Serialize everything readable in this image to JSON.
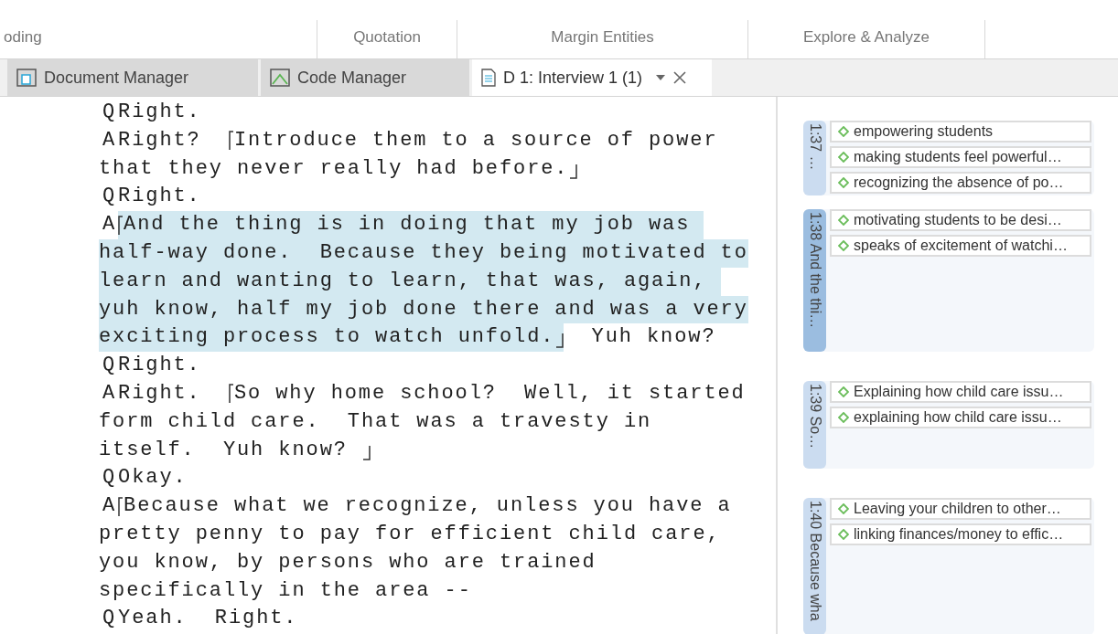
{
  "ribbon": {
    "groups": [
      "oding",
      "Quotation",
      "Margin Entities",
      "Explore & Analyze"
    ]
  },
  "tabs": [
    {
      "label": "Document Manager",
      "kind": "documents",
      "selected": false
    },
    {
      "label": "Code Manager",
      "kind": "codes",
      "selected": false
    },
    {
      "label": "D 1: Interview 1 (1)",
      "kind": "document",
      "selected": true
    }
  ],
  "transcript": [
    {
      "speaker": "Q",
      "segments": [
        {
          "text": "Right.",
          "highlighted": false,
          "quote_start": false,
          "quote_end": false
        }
      ]
    },
    {
      "speaker": "A",
      "segments": [
        {
          "text": "Right?  ",
          "highlighted": false,
          "quote_start": false,
          "quote_end": false
        },
        {
          "text": "Introduce them to a source of power",
          "highlighted": false,
          "quote_start": true,
          "quote_end": false
        }
      ]
    },
    {
      "segments": [
        {
          "text": "that they never really had before.",
          "highlighted": false,
          "quote_start": false,
          "quote_end": true
        }
      ]
    },
    {
      "speaker": "Q",
      "segments": [
        {
          "text": "Right.",
          "highlighted": false,
          "quote_start": false,
          "quote_end": false
        }
      ]
    },
    {
      "speaker": "A",
      "segments": [
        {
          "text": "And the thing is in doing that my job was ",
          "highlighted": true,
          "quote_start": true,
          "quote_end": false
        }
      ]
    },
    {
      "segments": [
        {
          "text": "half-way done.  Because they being motivated to",
          "highlighted": true,
          "quote_start": false,
          "quote_end": false
        }
      ]
    },
    {
      "segments": [
        {
          "text": "learn and wanting to learn, that was, again, ",
          "highlighted": true,
          "quote_start": false,
          "quote_end": false
        }
      ]
    },
    {
      "segments": [
        {
          "text": "yuh know, half my job done there and was a very",
          "highlighted": true,
          "quote_start": false,
          "quote_end": false
        }
      ]
    },
    {
      "segments": [
        {
          "text": "exciting process to watch unfold.",
          "highlighted": true,
          "quote_start": false,
          "quote_end": true
        },
        {
          "text": "  Yuh know?",
          "highlighted": false,
          "quote_start": false,
          "quote_end": false
        }
      ]
    },
    {
      "speaker": "Q",
      "segments": [
        {
          "text": "Right.",
          "highlighted": false,
          "quote_start": false,
          "quote_end": false
        }
      ]
    },
    {
      "speaker": "A",
      "segments": [
        {
          "text": "Right.  ",
          "highlighted": false,
          "quote_start": false,
          "quote_end": false
        },
        {
          "text": "So why home school?  Well, it started",
          "highlighted": false,
          "quote_start": true,
          "quote_end": false
        }
      ]
    },
    {
      "segments": [
        {
          "text": "form child care.  That was a travesty in",
          "highlighted": false,
          "quote_start": false,
          "quote_end": false
        }
      ]
    },
    {
      "segments": [
        {
          "text": "itself.  Yuh know? ",
          "highlighted": false,
          "quote_start": false,
          "quote_end": true
        }
      ]
    },
    {
      "speaker": "Q",
      "segments": [
        {
          "text": "Okay.",
          "highlighted": false,
          "quote_start": false,
          "quote_end": false
        }
      ]
    },
    {
      "speaker": "A",
      "segments": [
        {
          "text": "Because what we recognize, unless you have a",
          "highlighted": false,
          "quote_start": true,
          "quote_end": false
        }
      ]
    },
    {
      "segments": [
        {
          "text": "pretty penny to pay for efficient child care,",
          "highlighted": false,
          "quote_start": false,
          "quote_end": false
        }
      ]
    },
    {
      "segments": [
        {
          "text": "you know, by persons who are trained",
          "highlighted": false,
          "quote_start": false,
          "quote_end": false
        }
      ]
    },
    {
      "segments": [
        {
          "text": "specifically in the area --",
          "highlighted": false,
          "quote_start": false,
          "quote_end": false
        }
      ]
    },
    {
      "speaker": "Q",
      "segments": [
        {
          "text": "Yeah.  Right.",
          "highlighted": false,
          "quote_start": false,
          "quote_end": false
        }
      ]
    }
  ],
  "margin": [
    {
      "label": "1:37 …",
      "selected": false,
      "codes": [
        "empowering students",
        "making students feel powerful…",
        "recognizing the absence of po…"
      ]
    },
    {
      "label": "1:38 And the thi…",
      "selected": true,
      "codes": [
        "motivating students to be desi…",
        "speaks of excitement of watchi…"
      ]
    },
    {
      "label": "1:39 So…",
      "selected": false,
      "codes": [
        "Explaining how child care issu…",
        "explaining how child care issu…"
      ]
    },
    {
      "label": "1:40 Because wha",
      "selected": false,
      "codes": [
        "Leaving your children to other…",
        "linking finances/money to effic…"
      ]
    }
  ]
}
